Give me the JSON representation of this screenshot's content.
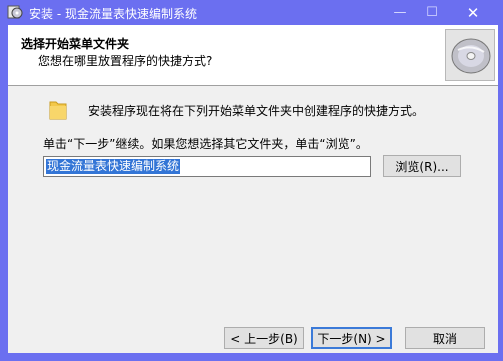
{
  "window": {
    "title": "安装 - 现金流量表快速编制系统",
    "minimize_glyph": "—",
    "maximize_glyph": "☐",
    "close_glyph": "✕"
  },
  "header": {
    "title": "选择开始菜单文件夹",
    "subtitle": "您想在哪里放置程序的快捷方式?"
  },
  "body": {
    "intro": "安装程序现在将在下列开始菜单文件夹中创建程序的快捷方式。",
    "hint": "单击“下一步”继续。如果您想选择其它文件夹，单击“浏览”。",
    "folder_value": "现金流量表快速编制系统"
  },
  "buttons": {
    "browse": "浏览(R)...",
    "back": "< 上一步(B)",
    "next": "下一步(N) >",
    "cancel": "取消"
  },
  "icons": {
    "app": "setup-app-icon",
    "cd": "cd-disc-icon",
    "folder": "folder-icon"
  },
  "colors": {
    "titlebar": "#6b6ff0",
    "selection": "#3375d6",
    "dialog_bg": "#f0f0f0"
  }
}
